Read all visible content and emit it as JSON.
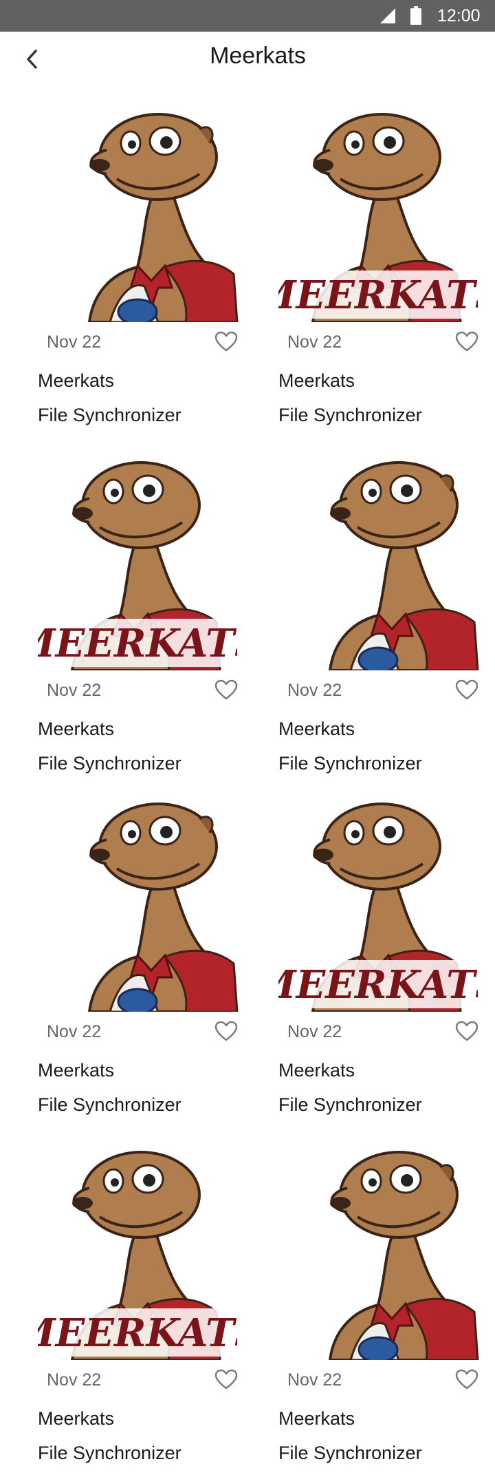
{
  "status_bar": {
    "time": "12:00"
  },
  "header": {
    "title": "Meerkats"
  },
  "grid": {
    "items": [
      {
        "date": "Nov 22",
        "title": "Meerkats",
        "subtitle": "File Synchronizer",
        "variant": "jersey"
      },
      {
        "date": "Nov 22",
        "title": "Meerkats",
        "subtitle": "File Synchronizer",
        "variant": "logo",
        "logo_text": "MEERKATS"
      },
      {
        "date": "Nov 22",
        "title": "Meerkats",
        "subtitle": "File Synchronizer",
        "variant": "logo",
        "logo_text": "MEERKATS"
      },
      {
        "date": "Nov 22",
        "title": "Meerkats",
        "subtitle": "File Synchronizer",
        "variant": "jersey"
      },
      {
        "date": "Nov 22",
        "title": "Meerkats",
        "subtitle": "File Synchronizer",
        "variant": "jersey"
      },
      {
        "date": "Nov 22",
        "title": "Meerkats",
        "subtitle": "File Synchronizer",
        "variant": "logo",
        "logo_text": "MEERKATS"
      },
      {
        "date": "Nov 22",
        "title": "Meerkats",
        "subtitle": "File Synchronizer",
        "variant": "logo",
        "logo_text": "MEERKATS"
      },
      {
        "date": "Nov 22",
        "title": "Meerkats",
        "subtitle": "File Synchronizer",
        "variant": "jersey"
      }
    ]
  },
  "icons": {
    "back": "chevron-left-icon",
    "like": "heart-outline-icon",
    "signal": "cell-signal-icon",
    "battery": "battery-icon"
  },
  "colors": {
    "status_bar": "#616161",
    "logo_red": "#7a1418",
    "fur": "#b07d4f",
    "cape": "#b3242a"
  }
}
